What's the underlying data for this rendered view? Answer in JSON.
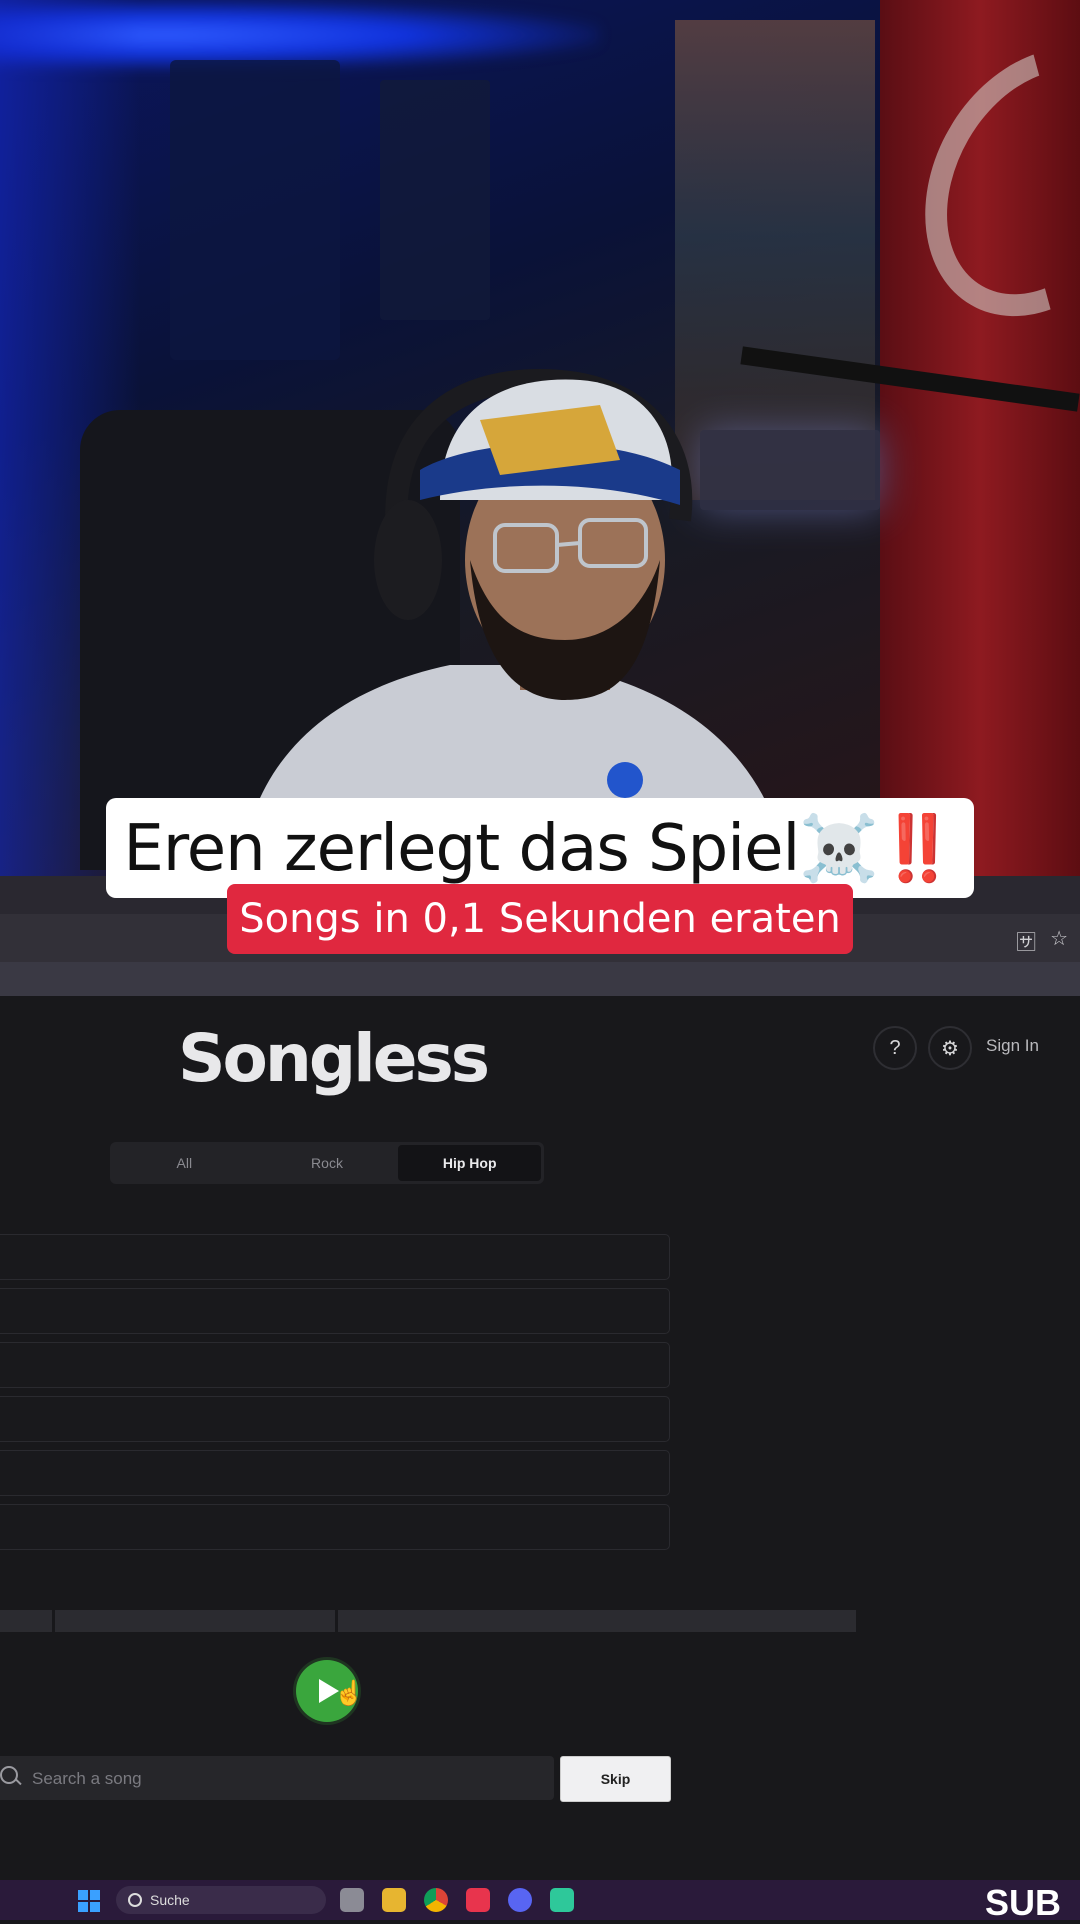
{
  "captions": {
    "main": "Eren zerlegt das Spiel☠️‼️",
    "sub": "Songs in 0,1 Sekunden eraten"
  },
  "app": {
    "logo": "Songless",
    "help_label": "?",
    "settings_icon": "⚙",
    "sign_in": "Sign In"
  },
  "genres": {
    "tabs": [
      "All",
      "Rock",
      "Hip Hop"
    ],
    "selected": "Hip Hop"
  },
  "guesses": {
    "rows": 6
  },
  "player": {
    "search_placeholder": "Search a song",
    "skip_label": "Skip"
  },
  "taskbar": {
    "search_label": "Suche",
    "corner_text": "SUB"
  },
  "browser": {
    "translate_icon": "translate-icon",
    "bookmark_icon": "☆"
  },
  "colors": {
    "caption_red": "#e0283f",
    "play_green": "#3aa63d",
    "page_bg": "#18181b"
  }
}
